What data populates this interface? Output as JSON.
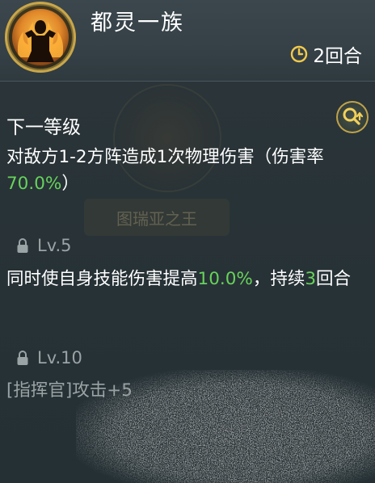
{
  "skill": {
    "name": "都灵一族",
    "icon": "warrior-flame-portrait-icon",
    "cooldown": "2回合"
  },
  "watermark": {
    "banner_text": "图瑞亚之王"
  },
  "next_level": {
    "title": "下一等级",
    "desc_pre": "对敌方1-2方阵造成1次物理伤害（伤害率",
    "desc_value": "70.0%",
    "desc_post": "）"
  },
  "levels": [
    {
      "label": "Lv.5",
      "desc_pre": "同时使自身技能伤害提高",
      "desc_value": "10.0%",
      "desc_mid": "，持续",
      "desc_value2": "3",
      "desc_post": "回合"
    },
    {
      "label": "Lv.10",
      "desc_pre": "[指挥官]攻击+5"
    }
  ],
  "colors": {
    "highlight": "#67d35a",
    "gold": "#c9a64a",
    "muted": "#9aa3a5"
  }
}
